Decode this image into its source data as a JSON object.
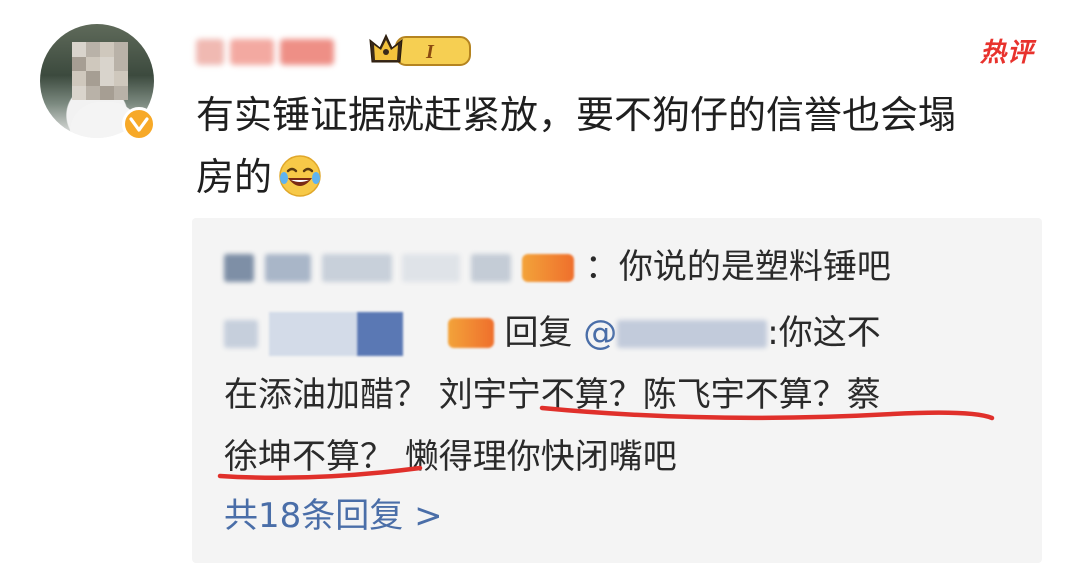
{
  "header": {
    "hot_label": "热评",
    "level_badge_text": "I"
  },
  "comment": {
    "text_line1": "有实锤证据就赶紧放，要不狗仔的信誉也会塌",
    "text_line2": "房的",
    "emoji": "laughing-tears-emoji"
  },
  "replies": {
    "first": {
      "separator": "：",
      "text": "你说的是塑料锤吧"
    },
    "second": {
      "reply_word": "回复",
      "mention_prefix": "@",
      "line1_tail": ":你这不",
      "line2": "在添油加醋？ 刘宇宁不算？陈飞宇不算？蔡",
      "line3": "徐坤不算？ 懒得理你快闭嘴吧"
    },
    "more_link": "共18条回复 >"
  },
  "colors": {
    "hot": "#e8322d",
    "link": "#4a6ea8",
    "underline": "#e0302b",
    "verified": "#f7a928"
  }
}
